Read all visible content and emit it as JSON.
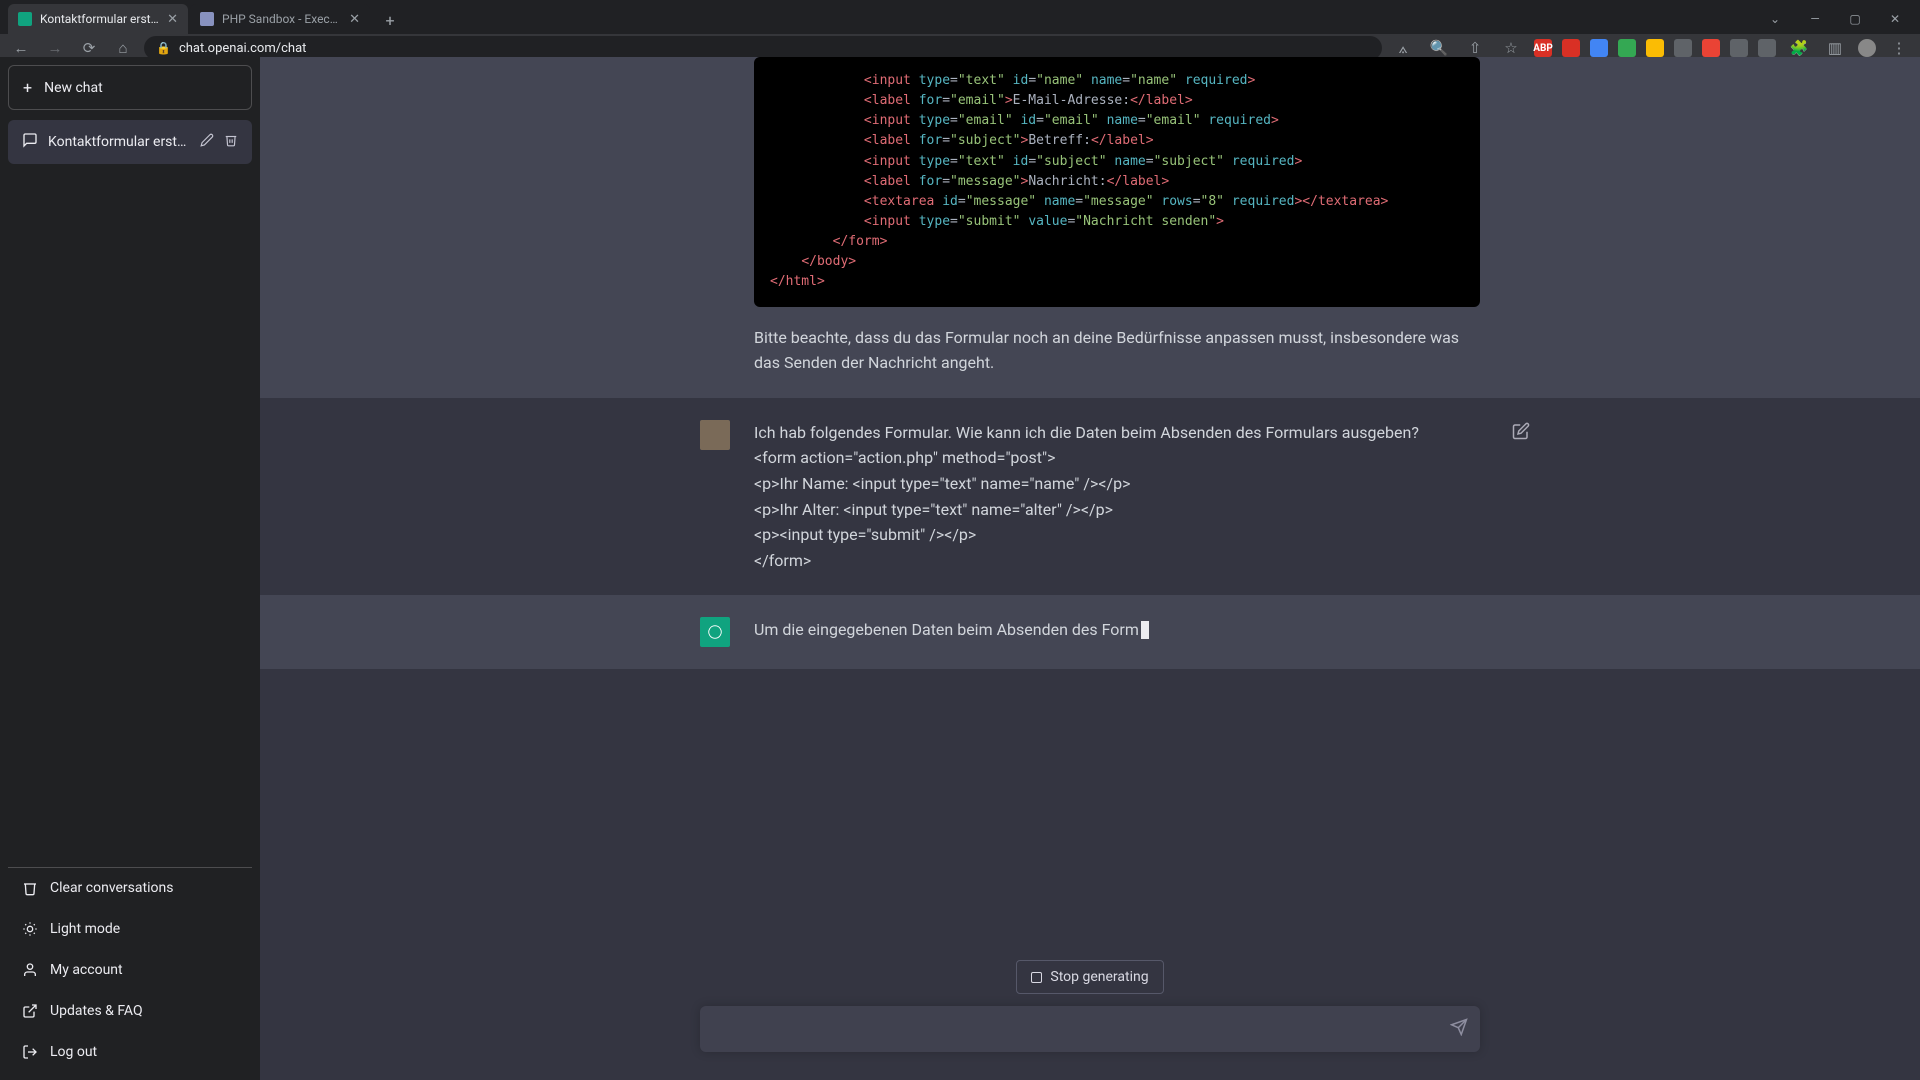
{
  "browser": {
    "tabs": [
      {
        "title": "Kontaktformular erstellen.",
        "active": true
      },
      {
        "title": "PHP Sandbox - Execute PHP cod",
        "active": false
      }
    ],
    "url": "chat.openai.com/chat"
  },
  "sidebar": {
    "new_chat_label": "New chat",
    "active_conversation": "Kontaktformular erstell",
    "links": {
      "clear": "Clear conversations",
      "light": "Light mode",
      "account": "My account",
      "updates": "Updates & FAQ",
      "logout": "Log out"
    }
  },
  "chat": {
    "msg0_code_lines": [
      [
        [
          "tkn-plain",
          "            "
        ],
        [
          "tkn-tag",
          "<input"
        ],
        [
          "tkn-plain",
          " "
        ],
        [
          "tkn-attr",
          "type"
        ],
        [
          "tkn-eq",
          "="
        ],
        [
          "tkn-val",
          "\"text\""
        ],
        [
          "tkn-plain",
          " "
        ],
        [
          "tkn-attr",
          "id"
        ],
        [
          "tkn-eq",
          "="
        ],
        [
          "tkn-val",
          "\"name\""
        ],
        [
          "tkn-plain",
          " "
        ],
        [
          "tkn-attr",
          "name"
        ],
        [
          "tkn-eq",
          "="
        ],
        [
          "tkn-val",
          "\"name\""
        ],
        [
          "tkn-plain",
          " "
        ],
        [
          "tkn-req",
          "required"
        ],
        [
          "tkn-tag",
          ">"
        ]
      ],
      [
        [
          "tkn-plain",
          "            "
        ],
        [
          "tkn-tag",
          "<label"
        ],
        [
          "tkn-plain",
          " "
        ],
        [
          "tkn-attr",
          "for"
        ],
        [
          "tkn-eq",
          "="
        ],
        [
          "tkn-val",
          "\"email\""
        ],
        [
          "tkn-tag",
          ">"
        ],
        [
          "tkn-plain",
          "E-Mail-Adresse:"
        ],
        [
          "tkn-tag",
          "</label>"
        ]
      ],
      [
        [
          "tkn-plain",
          "            "
        ],
        [
          "tkn-tag",
          "<input"
        ],
        [
          "tkn-plain",
          " "
        ],
        [
          "tkn-attr",
          "type"
        ],
        [
          "tkn-eq",
          "="
        ],
        [
          "tkn-val",
          "\"email\""
        ],
        [
          "tkn-plain",
          " "
        ],
        [
          "tkn-attr",
          "id"
        ],
        [
          "tkn-eq",
          "="
        ],
        [
          "tkn-val",
          "\"email\""
        ],
        [
          "tkn-plain",
          " "
        ],
        [
          "tkn-attr",
          "name"
        ],
        [
          "tkn-eq",
          "="
        ],
        [
          "tkn-val",
          "\"email\""
        ],
        [
          "tkn-plain",
          " "
        ],
        [
          "tkn-req",
          "required"
        ],
        [
          "tkn-tag",
          ">"
        ]
      ],
      [
        [
          "tkn-plain",
          "            "
        ],
        [
          "tkn-tag",
          "<label"
        ],
        [
          "tkn-plain",
          " "
        ],
        [
          "tkn-attr",
          "for"
        ],
        [
          "tkn-eq",
          "="
        ],
        [
          "tkn-val",
          "\"subject\""
        ],
        [
          "tkn-tag",
          ">"
        ],
        [
          "tkn-plain",
          "Betreff:"
        ],
        [
          "tkn-tag",
          "</label>"
        ]
      ],
      [
        [
          "tkn-plain",
          "            "
        ],
        [
          "tkn-tag",
          "<input"
        ],
        [
          "tkn-plain",
          " "
        ],
        [
          "tkn-attr",
          "type"
        ],
        [
          "tkn-eq",
          "="
        ],
        [
          "tkn-val",
          "\"text\""
        ],
        [
          "tkn-plain",
          " "
        ],
        [
          "tkn-attr",
          "id"
        ],
        [
          "tkn-eq",
          "="
        ],
        [
          "tkn-val",
          "\"subject\""
        ],
        [
          "tkn-plain",
          " "
        ],
        [
          "tkn-attr",
          "name"
        ],
        [
          "tkn-eq",
          "="
        ],
        [
          "tkn-val",
          "\"subject\""
        ],
        [
          "tkn-plain",
          " "
        ],
        [
          "tkn-req",
          "required"
        ],
        [
          "tkn-tag",
          ">"
        ]
      ],
      [
        [
          "tkn-plain",
          "            "
        ],
        [
          "tkn-tag",
          "<label"
        ],
        [
          "tkn-plain",
          " "
        ],
        [
          "tkn-attr",
          "for"
        ],
        [
          "tkn-eq",
          "="
        ],
        [
          "tkn-val",
          "\"message\""
        ],
        [
          "tkn-tag",
          ">"
        ],
        [
          "tkn-plain",
          "Nachricht:"
        ],
        [
          "tkn-tag",
          "</label>"
        ]
      ],
      [
        [
          "tkn-plain",
          "            "
        ],
        [
          "tkn-tag",
          "<textarea"
        ],
        [
          "tkn-plain",
          " "
        ],
        [
          "tkn-attr",
          "id"
        ],
        [
          "tkn-eq",
          "="
        ],
        [
          "tkn-val",
          "\"message\""
        ],
        [
          "tkn-plain",
          " "
        ],
        [
          "tkn-attr",
          "name"
        ],
        [
          "tkn-eq",
          "="
        ],
        [
          "tkn-val",
          "\"message\""
        ],
        [
          "tkn-plain",
          " "
        ],
        [
          "tkn-attr",
          "rows"
        ],
        [
          "tkn-eq",
          "="
        ],
        [
          "tkn-val",
          "\"8\""
        ],
        [
          "tkn-plain",
          " "
        ],
        [
          "tkn-req",
          "required"
        ],
        [
          "tkn-tag",
          "></textarea>"
        ]
      ],
      [
        [
          "tkn-plain",
          "            "
        ],
        [
          "tkn-tag",
          "<input"
        ],
        [
          "tkn-plain",
          " "
        ],
        [
          "tkn-attr",
          "type"
        ],
        [
          "tkn-eq",
          "="
        ],
        [
          "tkn-val",
          "\"submit\""
        ],
        [
          "tkn-plain",
          " "
        ],
        [
          "tkn-attr",
          "value"
        ],
        [
          "tkn-eq",
          "="
        ],
        [
          "tkn-val",
          "\"Nachricht senden\""
        ],
        [
          "tkn-tag",
          ">"
        ]
      ],
      [
        [
          "tkn-plain",
          "        "
        ],
        [
          "tkn-tag",
          "</form>"
        ]
      ],
      [
        [
          "tkn-plain",
          "    "
        ],
        [
          "tkn-tag",
          "</body>"
        ]
      ],
      [
        [
          "tkn-tag",
          "</html>"
        ]
      ]
    ],
    "msg0_text": "Bitte beachte, dass du das Formular noch an deine Bedürfnisse anpassen musst, insbesondere was das Senden der Nachricht angeht.",
    "msg1_lines": [
      "Ich hab folgendes Formular. Wie kann ich die Daten beim Absenden des Formulars ausgeben?",
      "<form action=\"action.php\" method=\"post\">",
      " <p>Ihr Name: <input type=\"text\" name=\"name\" /></p>",
      " <p>Ihr Alter: <input type=\"text\" name=\"alter\" /></p>",
      " <p><input type=\"submit\" /></p>",
      "</form>"
    ],
    "msg2_text": "Um die eingegebenen Daten beim Absenden des Form"
  },
  "controls": {
    "stop_label": "Stop generating",
    "input_placeholder": ""
  }
}
